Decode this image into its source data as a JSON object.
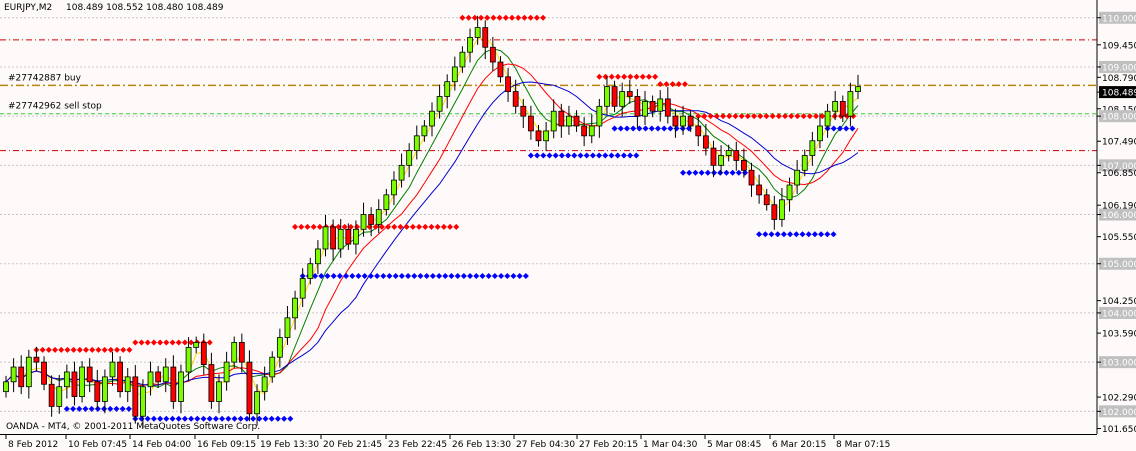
{
  "header": {
    "symbol": "EURJPY,M2",
    "ohlc": "108.489 108.552 108.480 108.489"
  },
  "footer": {
    "copyright": "OANDA - MT4, © 2001-2011 MetaQuotes Software Corp."
  },
  "orders": [
    {
      "label": "#27742887 buy",
      "price": 108.625,
      "color": "#b8860b",
      "style": "dashdot"
    },
    {
      "label": "#27742962 sell stop",
      "price": 108.05,
      "color": "#32cd32",
      "style": "dash"
    }
  ],
  "levels": [
    {
      "price": 109.55,
      "color": "#cc0000"
    },
    {
      "price": 107.3,
      "color": "#cc0000"
    }
  ],
  "price_tags": [
    {
      "text": "110.000",
      "price": 110.0,
      "bg": "#c0c0c0",
      "fg": "#ffffff"
    },
    {
      "text": "109.450",
      "price": 109.45,
      "bg": "",
      "fg": "#000000"
    },
    {
      "text": "109.000",
      "price": 109.0,
      "bg": "#c0c0c0",
      "fg": "#ffffff"
    },
    {
      "text": "108.790",
      "price": 108.79,
      "bg": "",
      "fg": "#000000"
    },
    {
      "text": "108.489",
      "price": 108.489,
      "bg": "#000000",
      "fg": "#ffffff"
    },
    {
      "text": "108.150",
      "price": 108.15,
      "bg": "",
      "fg": "#000000"
    },
    {
      "text": "108.000",
      "price": 108.0,
      "bg": "#c0c0c0",
      "fg": "#ffffff"
    },
    {
      "text": "107.490",
      "price": 107.49,
      "bg": "",
      "fg": "#000000"
    },
    {
      "text": "107.000",
      "price": 107.0,
      "bg": "#c0c0c0",
      "fg": "#ffffff"
    },
    {
      "text": "106.850",
      "price": 106.85,
      "bg": "",
      "fg": "#000000"
    },
    {
      "text": "106.190",
      "price": 106.19,
      "bg": "",
      "fg": "#000000"
    },
    {
      "text": "106.000",
      "price": 106.0,
      "bg": "#c0c0c0",
      "fg": "#ffffff"
    },
    {
      "text": "105.550",
      "price": 105.55,
      "bg": "",
      "fg": "#000000"
    },
    {
      "text": "105.000",
      "price": 105.0,
      "bg": "#c0c0c0",
      "fg": "#ffffff"
    },
    {
      "text": "104.250",
      "price": 104.25,
      "bg": "",
      "fg": "#000000"
    },
    {
      "text": "104.000",
      "price": 104.0,
      "bg": "#c0c0c0",
      "fg": "#ffffff"
    },
    {
      "text": "103.590",
      "price": 103.59,
      "bg": "",
      "fg": "#000000"
    },
    {
      "text": "103.000",
      "price": 103.0,
      "bg": "#c0c0c0",
      "fg": "#ffffff"
    },
    {
      "text": "102.290",
      "price": 102.29,
      "bg": "",
      "fg": "#000000"
    },
    {
      "text": "102.000",
      "price": 102.0,
      "bg": "#c0c0c0",
      "fg": "#ffffff"
    },
    {
      "text": "101.650",
      "price": 101.65,
      "bg": "",
      "fg": "#000000"
    }
  ],
  "chart_data": {
    "type": "candlestick",
    "ylim": [
      101.6,
      110.3
    ],
    "y_ticks": [
      110.0,
      109.45,
      109.0,
      108.79,
      108.489,
      108.15,
      108.0,
      107.49,
      107.0,
      106.85,
      106.19,
      106.0,
      105.55,
      105.0,
      104.25,
      104.0,
      103.59,
      103.0,
      102.29,
      102.0,
      101.65
    ],
    "x_labels": [
      "8 Feb 2012",
      "10 Feb 07:45",
      "14 Feb 04:00",
      "16 Feb 09:15",
      "19 Feb 13:30",
      "20 Feb 21:45",
      "23 Feb 22:45",
      "26 Feb 13:30",
      "27 Feb 04:30",
      "27 Feb 20:15",
      "1 Mar 04:30",
      "5 Mar 08:45",
      "6 Mar 20:15",
      "8 Mar 07:15"
    ],
    "closes": [
      102.6,
      102.9,
      102.5,
      103.1,
      103.0,
      102.55,
      102.1,
      102.5,
      102.8,
      102.3,
      102.9,
      102.6,
      102.2,
      102.7,
      103.0,
      102.4,
      102.7,
      101.9,
      102.5,
      102.8,
      102.6,
      102.9,
      102.2,
      102.8,
      103.3,
      103.4,
      102.95,
      102.2,
      102.6,
      103.0,
      103.4,
      103.0,
      101.95,
      102.4,
      102.7,
      103.1,
      103.5,
      103.9,
      104.3,
      104.7,
      105.0,
      105.3,
      105.75,
      105.3,
      105.7,
      105.4,
      105.7,
      106.0,
      105.8,
      106.1,
      106.4,
      106.7,
      107.0,
      107.3,
      107.6,
      107.8,
      108.1,
      108.4,
      108.7,
      109.0,
      109.3,
      109.6,
      109.8,
      109.4,
      109.1,
      108.8,
      108.5,
      108.2,
      108.0,
      107.7,
      107.5,
      107.7,
      108.1,
      107.8,
      108.0,
      107.8,
      107.6,
      107.8,
      108.2,
      108.6,
      108.2,
      108.5,
      108.4,
      108.0,
      108.3,
      108.1,
      108.35,
      108.0,
      107.8,
      108.0,
      107.8,
      107.6,
      107.35,
      107.0,
      107.2,
      107.3,
      107.1,
      106.9,
      106.6,
      106.4,
      106.2,
      105.9,
      106.3,
      106.6,
      106.9,
      107.2,
      107.5,
      107.8,
      108.1,
      108.3,
      108.0,
      108.5,
      108.6
    ]
  }
}
